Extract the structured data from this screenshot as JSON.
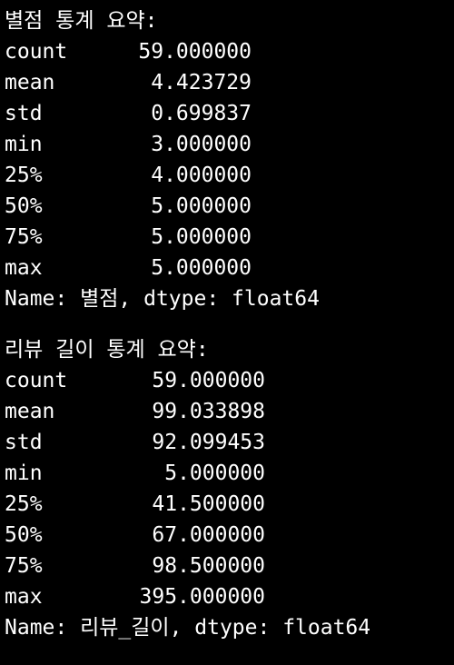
{
  "output": {
    "block1": {
      "header": "별점 통계 요약:",
      "rows": [
        {
          "label": "count",
          "value": "59.000000"
        },
        {
          "label": "mean",
          "value": "4.423729"
        },
        {
          "label": "std",
          "value": "0.699837"
        },
        {
          "label": "min",
          "value": "3.000000"
        },
        {
          "label": "25%",
          "value": "4.000000"
        },
        {
          "label": "50%",
          "value": "5.000000"
        },
        {
          "label": "75%",
          "value": "5.000000"
        },
        {
          "label": "max",
          "value": "5.000000"
        }
      ],
      "footer": "Name: 별점, dtype: float64"
    },
    "block2": {
      "header": "리뷰 길이 통계 요약:",
      "rows": [
        {
          "label": "count",
          "value": "59.000000"
        },
        {
          "label": "mean",
          "value": "99.033898"
        },
        {
          "label": "std",
          "value": "92.099453"
        },
        {
          "label": "min",
          "value": "5.000000"
        },
        {
          "label": "25%",
          "value": "41.500000"
        },
        {
          "label": "50%",
          "value": "67.000000"
        },
        {
          "label": "75%",
          "value": "98.500000"
        },
        {
          "label": "max",
          "value": "395.000000"
        }
      ],
      "footer": "Name: 리뷰_길이, dtype: float64"
    }
  },
  "colors": {
    "background": "#000000",
    "text": "#ffffff"
  }
}
